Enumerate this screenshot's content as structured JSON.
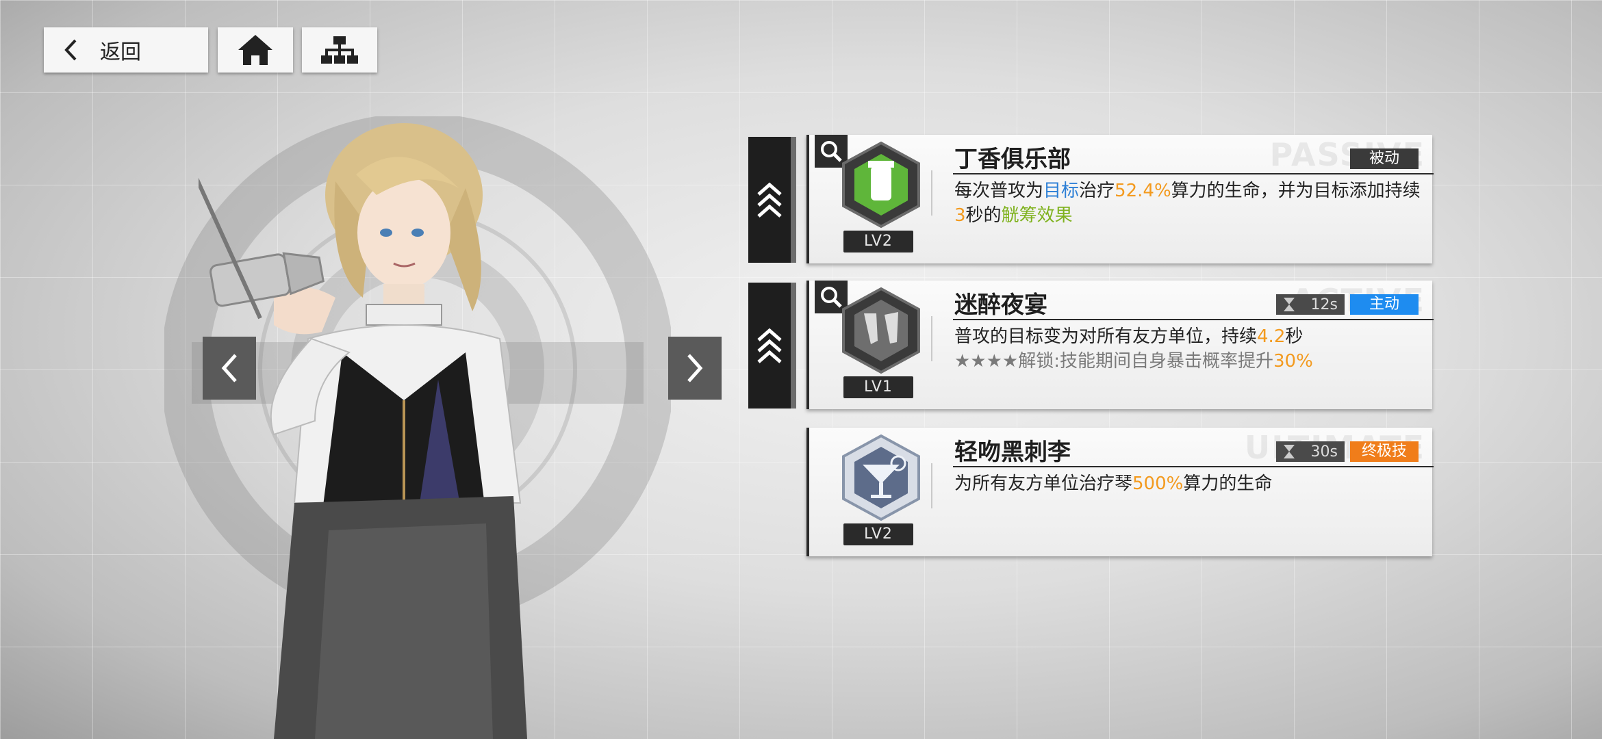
{
  "nav": {
    "back_label": "返回"
  },
  "skills": [
    {
      "name": "丁香俱乐部",
      "level": "LV2",
      "type": "被动",
      "type_color": "#3a3a3a",
      "cooldown": "",
      "desc_parts": [
        {
          "t": "每次普攻为",
          "c": ""
        },
        {
          "t": "目标",
          "c": "blue"
        },
        {
          "t": "治疗",
          "c": ""
        },
        {
          "t": "52.4%",
          "c": "orange"
        },
        {
          "t": "算力的生命，并为目标添加持续",
          "c": ""
        },
        {
          "t": "3",
          "c": "orange"
        },
        {
          "t": "秒的",
          "c": ""
        },
        {
          "t": "觥筹效果",
          "c": "green"
        }
      ],
      "watermark": "PASSIVE"
    },
    {
      "name": "迷醉夜宴",
      "level": "LV1",
      "type": "主动",
      "type_color": "#1e8cf0",
      "cooldown": "12s",
      "desc_parts": [
        {
          "t": "普攻的目标变为对所有友方单位，持续",
          "c": ""
        },
        {
          "t": "4.2",
          "c": "orange"
        },
        {
          "t": "秒",
          "c": ""
        }
      ],
      "desc2_parts": [
        {
          "t": "★★★★解锁:技能期间自身暴击概率提升",
          "c": "muted"
        },
        {
          "t": "30%",
          "c": "orange"
        }
      ],
      "watermark": "ACTIVE"
    },
    {
      "name": "轻吻黑刺李",
      "level": "LV2",
      "type": "终极技",
      "type_color": "#f07d1a",
      "cooldown": "30s",
      "desc_parts": [
        {
          "t": "为所有友方单位治疗琴",
          "c": ""
        },
        {
          "t": "500%",
          "c": "orange"
        },
        {
          "t": "算力的生命",
          "c": ""
        }
      ],
      "watermark": "ULTIMATE"
    }
  ],
  "colors": {
    "accent_orange": "#f39a1e",
    "accent_blue": "#2c7fd6",
    "accent_green": "#7fb21e"
  }
}
